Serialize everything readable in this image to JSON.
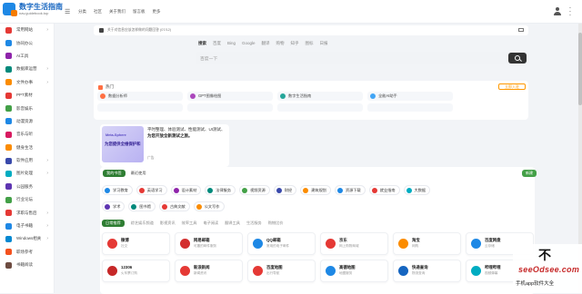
{
  "header": {
    "logo_title": "数字生活指南",
    "logo_url": "nav.guidebook.top",
    "menu_icon": "hamburger-icon",
    "nav": [
      "分类",
      "社区",
      "关于我们",
      "留言板",
      "更多"
    ]
  },
  "sidebar": {
    "items": [
      {
        "label": "常用网站",
        "color": "#e53935"
      },
      {
        "label": "协同办公",
        "color": "#1e88e5"
      },
      {
        "label": "AI工具",
        "color": "#8e24aa"
      },
      {
        "label": "数据库运营",
        "color": "#00897b"
      },
      {
        "label": "文件办事",
        "color": "#fb8c00"
      },
      {
        "label": "PPT素材",
        "color": "#e53935"
      },
      {
        "label": "影音娱乐",
        "color": "#43a047"
      },
      {
        "label": "动漫资源",
        "color": "#1e88e5"
      },
      {
        "label": "音乐与听",
        "color": "#d81b60"
      },
      {
        "label": "健身生活",
        "color": "#fb8c00"
      },
      {
        "label": "软件应用",
        "color": "#3949ab"
      },
      {
        "label": "图片处理",
        "color": "#00acc1"
      },
      {
        "label": "公园服务",
        "color": "#5e35b1"
      },
      {
        "label": "行业论坛",
        "color": "#43a047"
      },
      {
        "label": "求职与售后",
        "color": "#e53935"
      },
      {
        "label": "电子书籍",
        "color": "#1e88e5"
      },
      {
        "label": "Windows相关",
        "color": "#0288d1"
      },
      {
        "label": "职场参考",
        "color": "#f4511e"
      },
      {
        "label": "书籍阅读",
        "color": "#6d4c41"
      }
    ]
  },
  "notice": {
    "text": "关于对信息应该怎样做的问题回答 (07/12)"
  },
  "search": {
    "tabs": [
      "搜索",
      "百度",
      "Bing",
      "Google",
      "翻译",
      "购物",
      "知乎",
      "图标",
      "日报"
    ],
    "placeholder": "百度一下"
  },
  "hot": {
    "title": "热门",
    "button": "立即入驻",
    "items": [
      {
        "label": "数据分析师",
        "color": "#ff7043"
      },
      {
        "label": "GPT图像绘图",
        "color": "#ab47bc"
      },
      {
        "label": "数字生活指南",
        "color": "#26a69a"
      },
      {
        "label": "全能AI助手",
        "color": "#42a5f5"
      }
    ]
  },
  "ad": {
    "img_line1": "Meta-Sphere",
    "img_line2": "为您提供全维保护和",
    "text": "平时整理、体验测试、性能测试、UI测试、",
    "text_bold": "为您开放全新测试之旅。",
    "tag": "广告"
  },
  "favorites": {
    "tabs": [
      "我的书签",
      "最近使用"
    ],
    "tag": "新建",
    "row1": [
      {
        "label": "学习教育",
        "color": "#1e88e5"
      },
      {
        "label": "英语学习",
        "color": "#e53935"
      },
      {
        "label": "设计素材",
        "color": "#8e24aa"
      },
      {
        "label": "法律服务",
        "color": "#00897b"
      },
      {
        "label": "视频资源",
        "color": "#43a047"
      },
      {
        "label": "财经",
        "color": "#3949ab"
      },
      {
        "label": "建筑规划",
        "color": "#fb8c00"
      },
      {
        "label": "资源下载",
        "color": "#1e88e5"
      },
      {
        "label": "就业指南",
        "color": "#e53935"
      },
      {
        "label": "大数据",
        "color": "#00acc1"
      }
    ],
    "row2": [
      {
        "label": "学术",
        "color": "#5e35b1"
      },
      {
        "label": "图书馆",
        "color": "#00897b"
      },
      {
        "label": "古典文献",
        "color": "#e53935"
      },
      {
        "label": "公文写作",
        "color": "#fb8c00"
      }
    ]
  },
  "categories": {
    "tabs": [
      "日常推荐",
      "综艺娱乐频道",
      "影视资讯",
      "效率工具",
      "电子阅读",
      "翻译工具",
      "生活服务",
      "购物比价"
    ]
  },
  "sites": [
    {
      "name": "微博",
      "desc": "社交",
      "color": "#e53935"
    },
    {
      "name": "网易邮箱",
      "desc": "可靠的邮件服务",
      "color": "#d32f2f"
    },
    {
      "name": "QQ邮箱",
      "desc": "常用的电子邮件",
      "color": "#1e88e5"
    },
    {
      "name": "京东",
      "desc": "网上购物商城",
      "color": "#e53935"
    },
    {
      "name": "淘宝",
      "desc": "网购",
      "color": "#fb8c00"
    },
    {
      "name": "百度网盘",
      "desc": "云存储",
      "color": "#1e88e5"
    },
    {
      "name": "12306",
      "desc": "火车票订购",
      "color": "#c62828"
    },
    {
      "name": "新浪新闻",
      "desc": "新闻资讯",
      "color": "#e53935"
    },
    {
      "name": "百度地图",
      "desc": "出行导航",
      "color": "#e53935"
    },
    {
      "name": "高德地图",
      "desc": "地图服务",
      "color": "#1e88e5"
    },
    {
      "name": "快递查询",
      "desc": "物流查询",
      "color": "#1565c0"
    },
    {
      "name": "哔哩哔哩",
      "desc": "视频弹幕",
      "color": "#00acc1"
    }
  ],
  "watermark": {
    "mark": "不",
    "big": "seeOdsee.com",
    "small": "手机app软件大全"
  }
}
